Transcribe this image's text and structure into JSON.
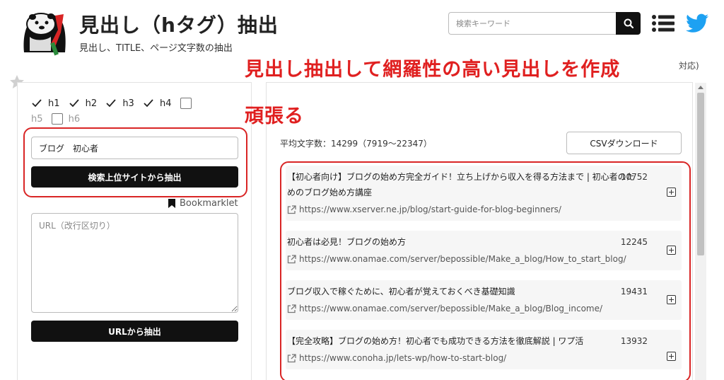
{
  "header": {
    "title": "見出し（hタグ）抽出",
    "subtitle": "見出し、TITLE、ページ文字数の抽出",
    "search_placeholder": "検索キーワード",
    "cut_text": "対応)"
  },
  "annotation": {
    "line1": "見出し抽出して網羅性の高い見出しを作成",
    "line2": "頑張る",
    "color": "#e02020"
  },
  "options": {
    "headings": [
      {
        "label": "h1",
        "checked": true
      },
      {
        "label": "h2",
        "checked": true
      },
      {
        "label": "h3",
        "checked": true
      },
      {
        "label": "h4",
        "checked": true
      },
      {
        "label": "h5",
        "checked": false
      },
      {
        "label": "h6",
        "checked": false
      }
    ]
  },
  "keyword": {
    "value": "ブログ　初心者",
    "button": "検索上位サイトから抽出"
  },
  "bookmarklet": "Bookmarklet",
  "url_input": {
    "placeholder": "URL（改行区切り）",
    "button": "URLから抽出"
  },
  "results": {
    "average": "平均文字数：14299（7919〜22347）",
    "csv_button": "CSVダウンロード",
    "items": [
      {
        "title": "【初心者向け】ブログの始め方完全ガイド！立ち上げから収入を得る方法まで | 初心者のためのブログ始め方講座",
        "count": "10752",
        "url": "https://www.xserver.ne.jp/blog/start-guide-for-blog-beginners/"
      },
      {
        "title": "初心者は必見！ブログの始め方",
        "count": "12245",
        "url": "https://www.onamae.com/server/bepossible/Make_a_blog/How_to_start_blog/"
      },
      {
        "title": "ブログ収入で稼ぐために、初心者が覚えておくべき基礎知識",
        "count": "19431",
        "url": "https://www.onamae.com/server/bepossible/Make_a_blog/Blog_income/"
      },
      {
        "title": "【完全攻略】ブログの始め方！初心者でも成功できる方法を徹底解説 | ワプ活",
        "count": "13932",
        "url": "https://www.conoha.jp/lets-wp/how-to-start-blog/"
      }
    ]
  },
  "colors": {
    "accent_red": "#d92525",
    "button_dark": "#111111",
    "twitter_blue": "#1da1f2"
  },
  "icons": [
    "otter-logo-icon",
    "search-icon",
    "menu-icon",
    "twitter-icon",
    "star-icon",
    "bookmark-icon",
    "external-link-icon",
    "expand-plus-icon",
    "check-icon"
  ]
}
